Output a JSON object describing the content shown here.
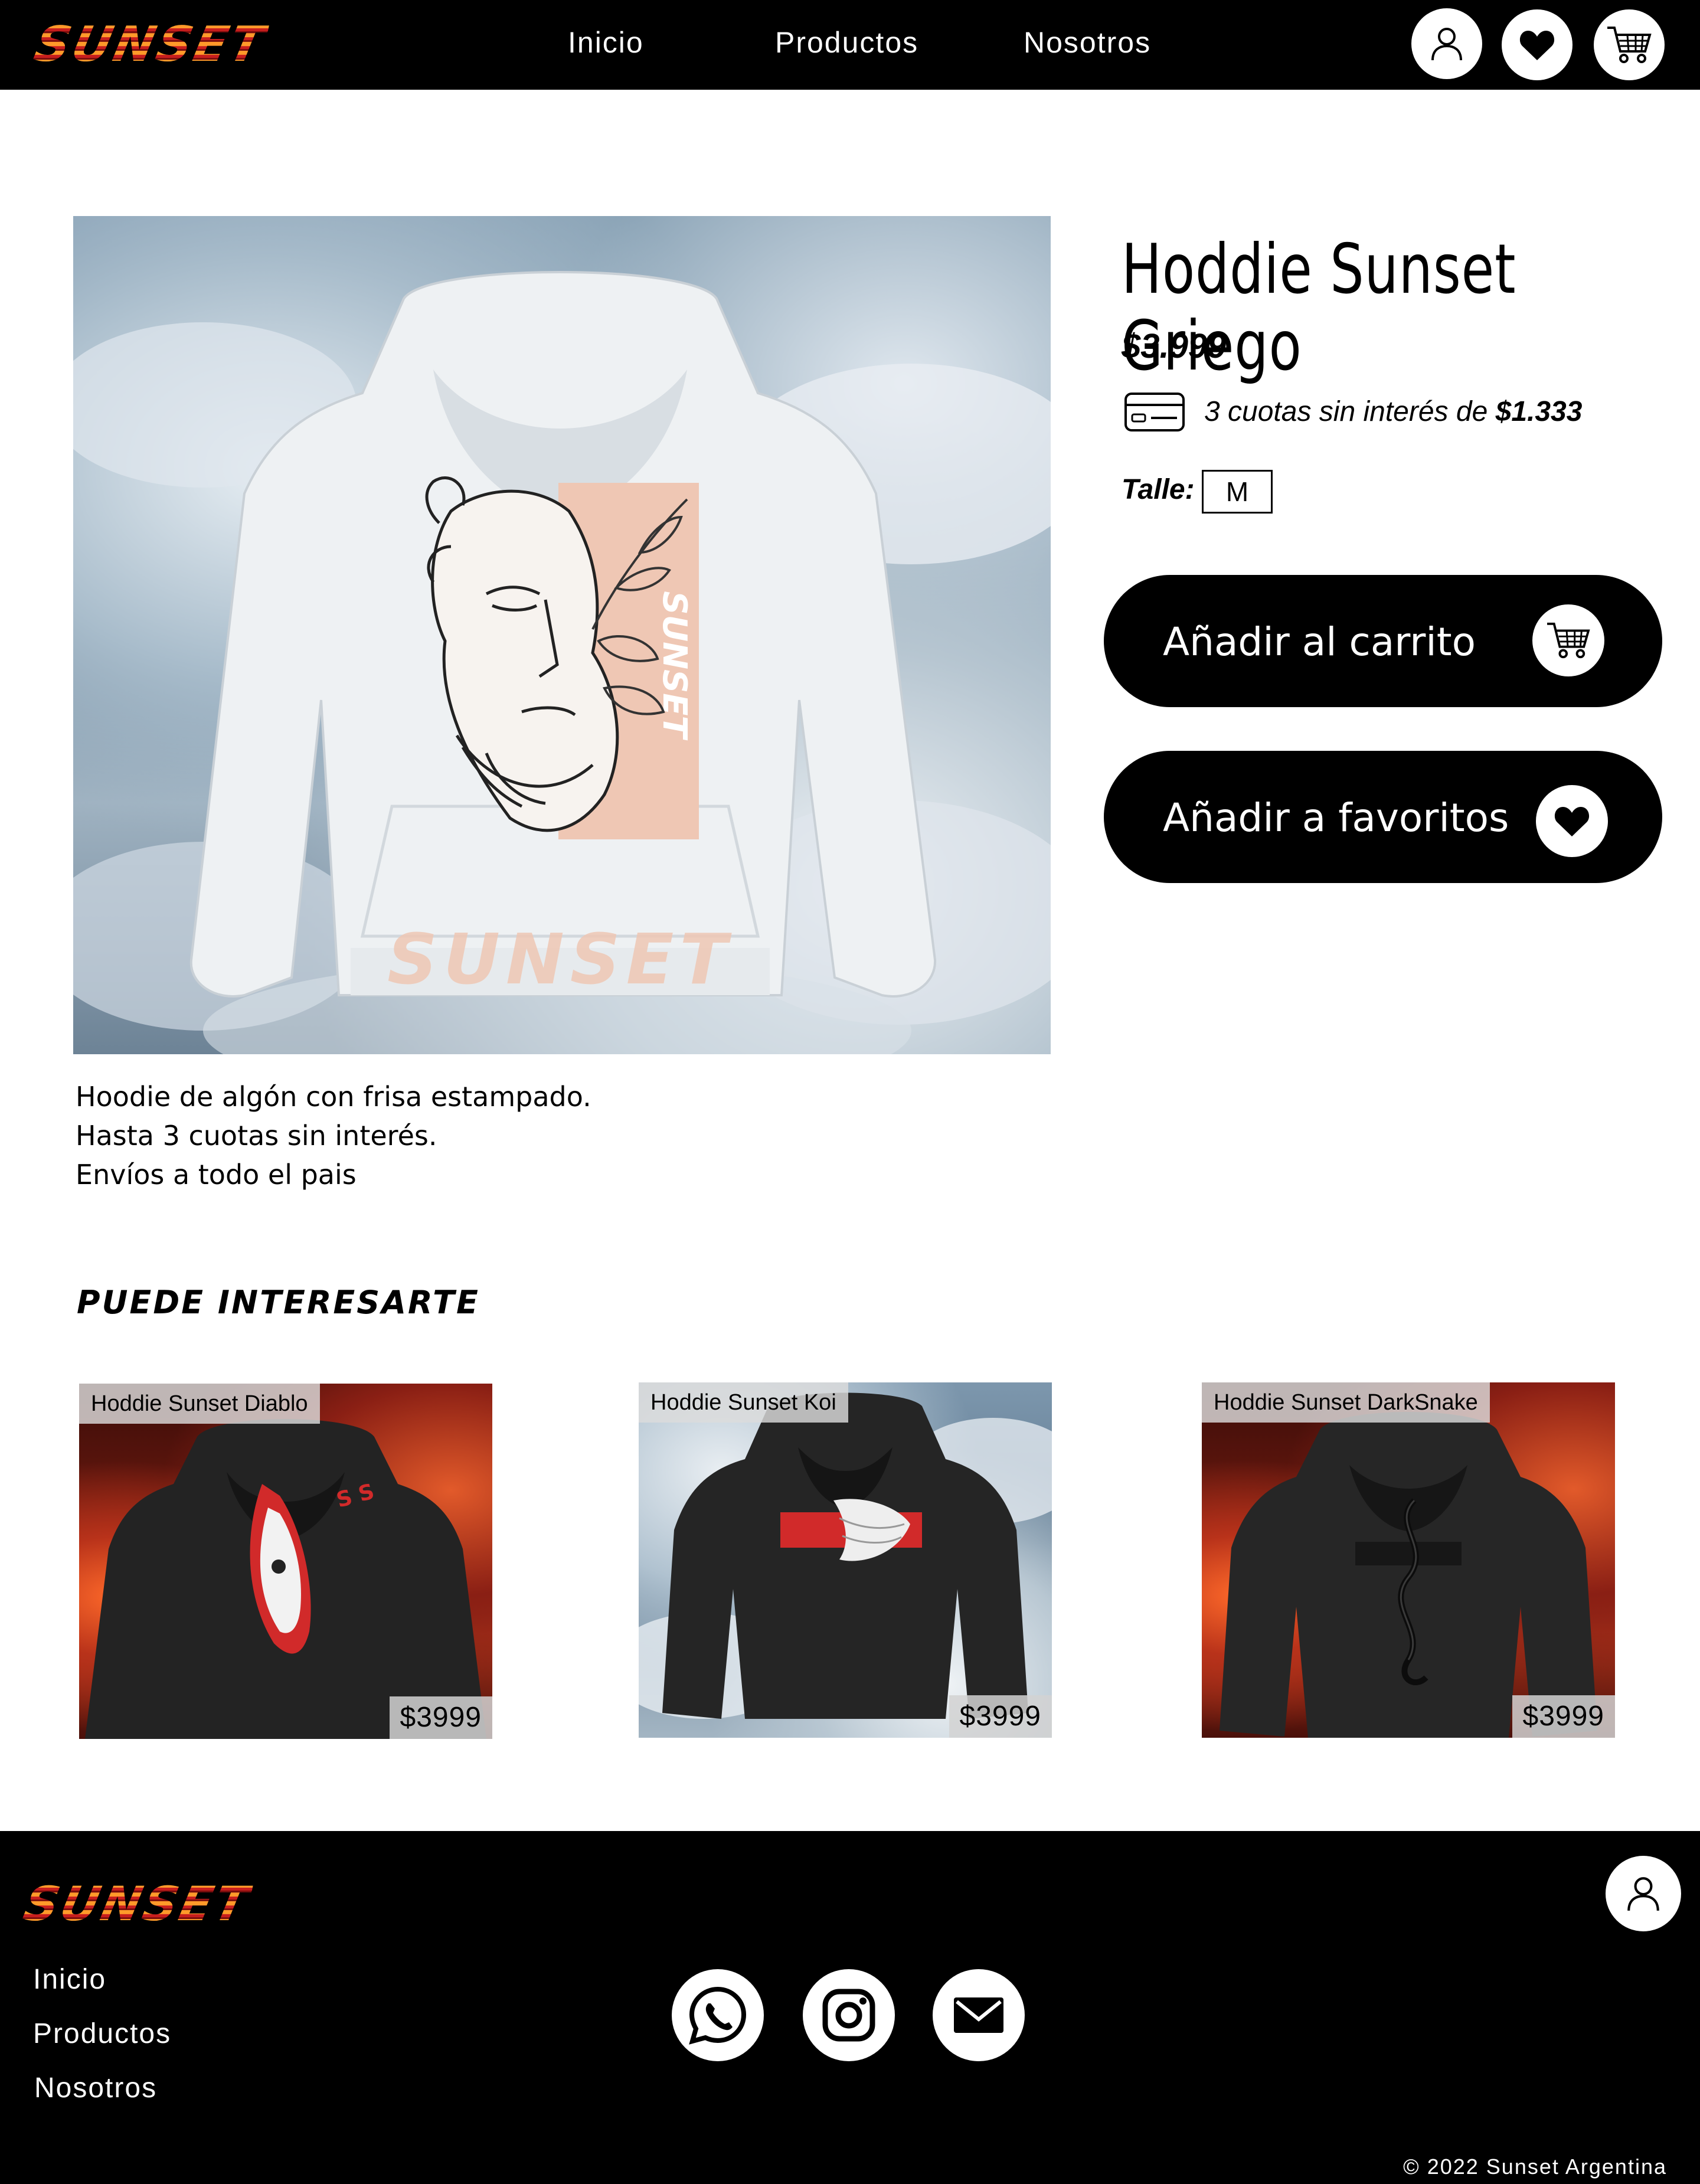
{
  "header": {
    "logo": "SUNSET",
    "nav": [
      "Inicio",
      "Productos",
      "Nosotros"
    ],
    "icons": [
      "user-icon",
      "heart-icon",
      "cart-icon"
    ]
  },
  "product": {
    "title": "Hoddie Sunset Griego",
    "price": "$3.999",
    "installments_text": "3 cuotas sin interés de",
    "installments_amount": "$1.333",
    "size_label": "Talle:",
    "size_value": "M",
    "hoodie_print_text": "SUNSET",
    "add_to_cart_label": "Añadir al carrito",
    "add_to_favorites_label": "Añadir a favoritos",
    "description": [
      "Hoodie de algón con frisa estampado.",
      "Hasta 3 cuotas sin interés.",
      "Envíos a todo el pais"
    ]
  },
  "related": {
    "title": "PUEDE INTERESARTE",
    "items": [
      {
        "name": "Hoddie Sunset Diablo",
        "price": "$3999",
        "background": "fire",
        "print_color": "#d12a2a"
      },
      {
        "name": "Hoddie Sunset Koi",
        "price": "$3999",
        "background": "sky",
        "print_color": "#d12a2a"
      },
      {
        "name": "Hoddie Sunset DarkSnake",
        "price": "$3999",
        "background": "fire",
        "print_color": "#111111"
      }
    ]
  },
  "footer": {
    "logo": "SUNSET",
    "links": [
      "Inicio",
      "Productos",
      "Nosotros"
    ],
    "social": [
      "whatsapp-icon",
      "instagram-icon",
      "mail-icon"
    ],
    "copyright": "© 2022 Sunset Argentina"
  },
  "colors": {
    "header_bg": "#000000",
    "accent_peach": "#efc7b4",
    "logo_orange": "#ff9a2a",
    "logo_red": "#c81e1e"
  }
}
